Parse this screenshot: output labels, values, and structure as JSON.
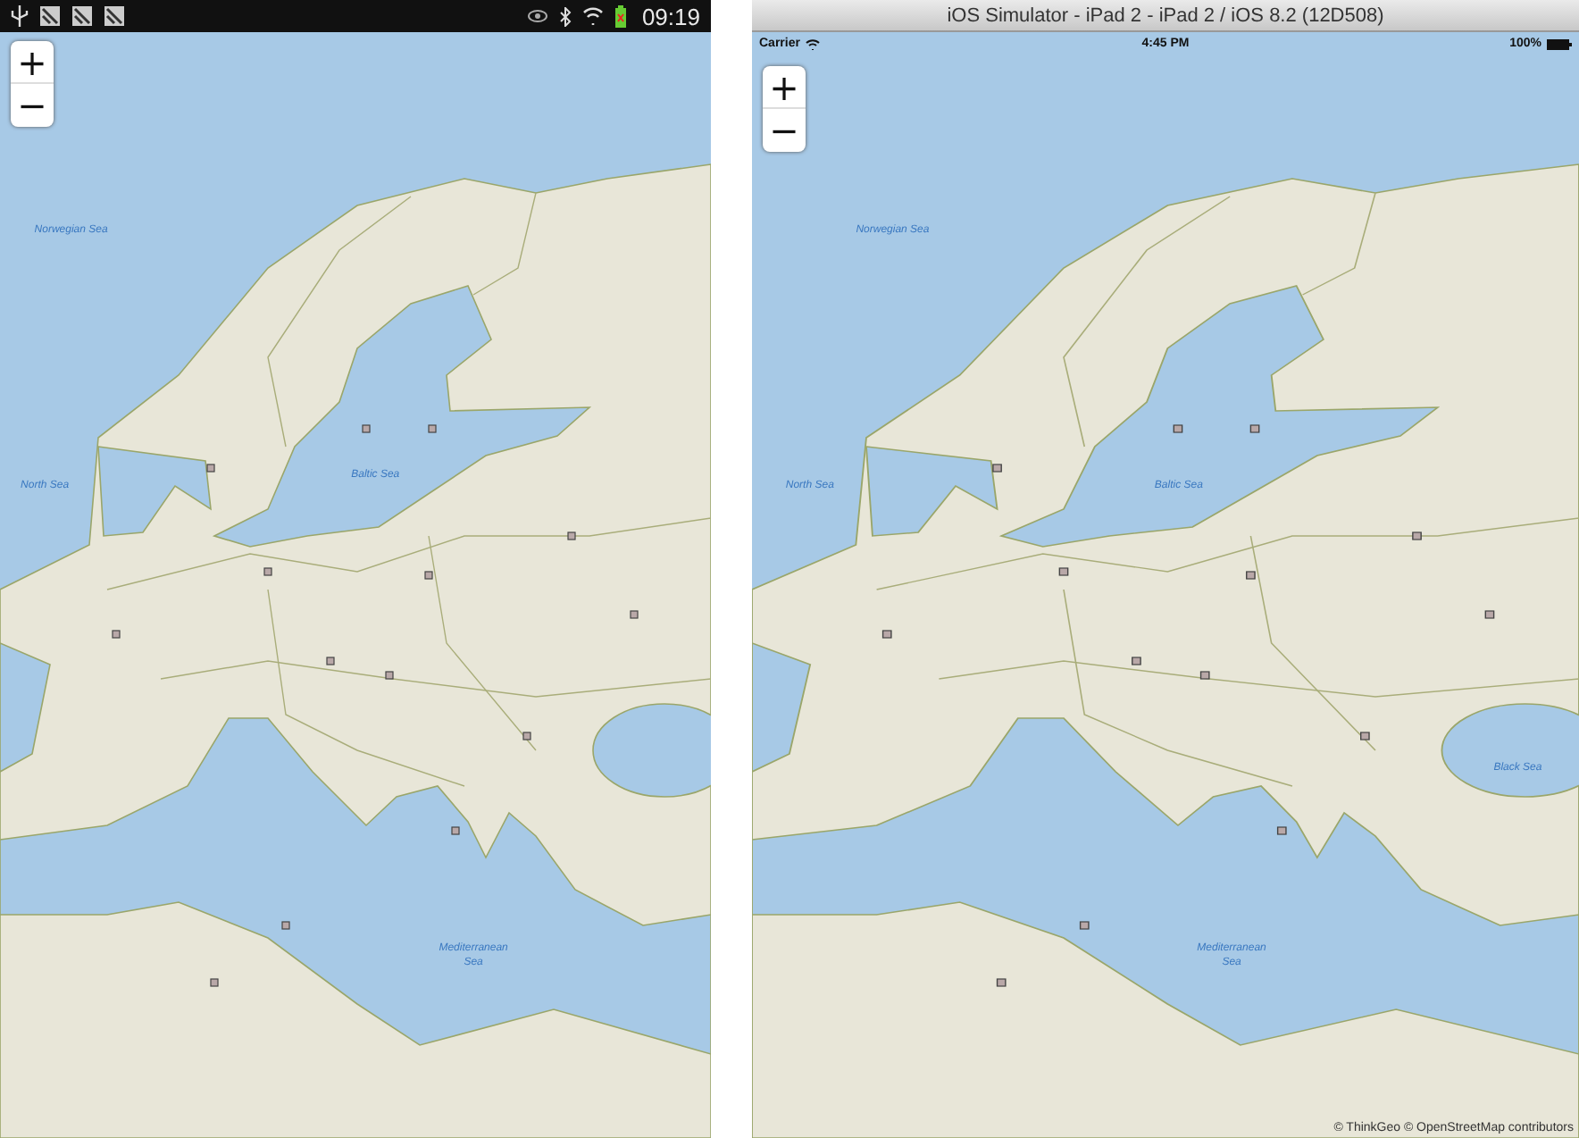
{
  "android": {
    "status_bar": {
      "time": "09:19"
    },
    "zoom_buttons": [
      "+",
      "−"
    ],
    "sea_labels": [
      "Norwegian Sea",
      "North Sea",
      "Baltic Sea",
      "Mediterranean Sea"
    ]
  },
  "ios": {
    "window": {
      "title": "iOS Simulator - iPad 2 - iPad 2 / iOS 8.2 (12D508)"
    },
    "status_bar": {
      "carrier": "Carrier",
      "time": "4:45 PM",
      "battery": "100%"
    },
    "zoom_buttons": [
      "+",
      "−"
    ],
    "sea_labels": [
      "Norwegian Sea",
      "North Sea",
      "Baltic Sea",
      "Mediterranean Sea",
      "Black Sea"
    ],
    "attribution": "© ThinkGeo © OpenStreetMap contributors"
  }
}
